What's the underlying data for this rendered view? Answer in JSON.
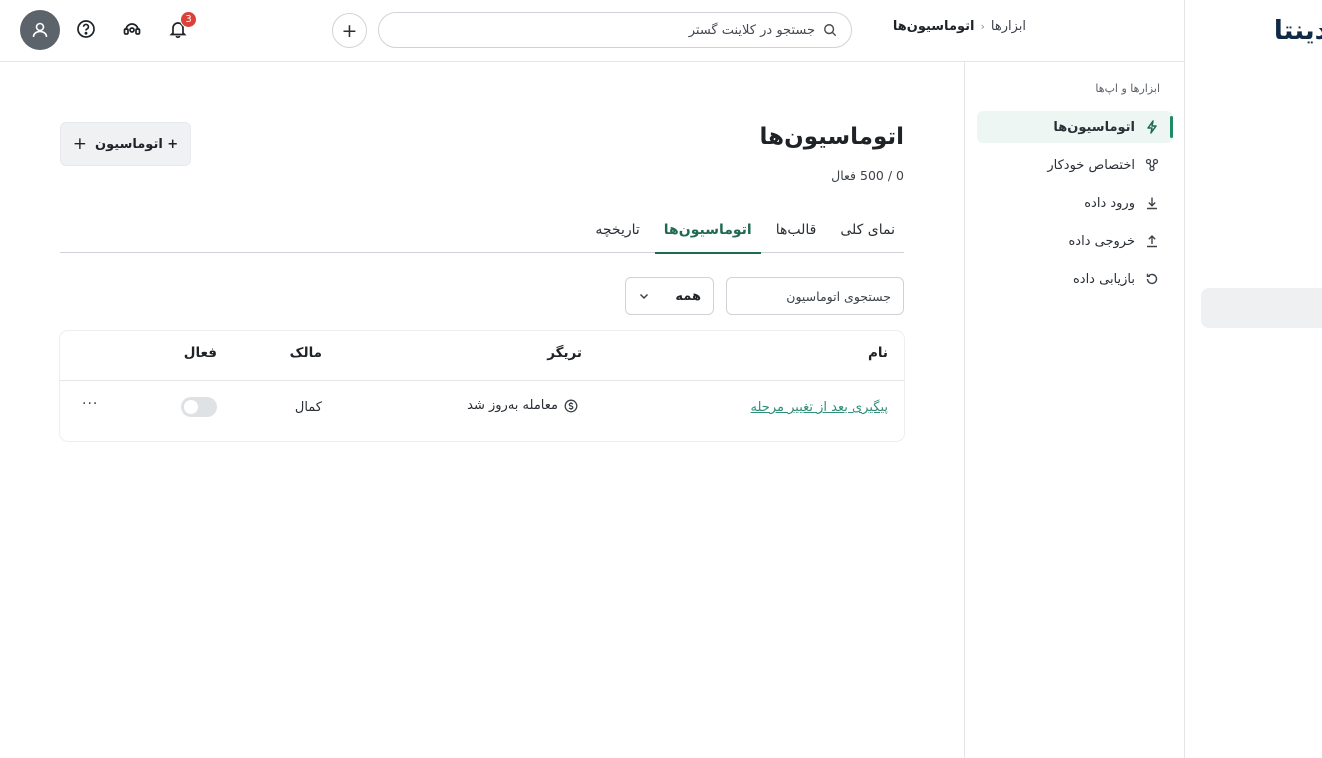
{
  "brand": {
    "logo_text": "دینتا"
  },
  "topbar": {
    "notification_count": "3",
    "search_placeholder": "جستجو در کلاینت گستر",
    "plus_label": "+",
    "breadcrumb": {
      "parent": "ابزارها",
      "separator": "‹",
      "current": "اتوماسیون‌ها"
    }
  },
  "sidebar": {
    "section_label": "ابزارها و اپ‌ها",
    "items": [
      {
        "label": "اتوماسیون‌ها",
        "icon": "bolt-icon",
        "active": true
      },
      {
        "label": "اختصاص خودکار",
        "icon": "share-icon",
        "active": false
      },
      {
        "label": "ورود داده",
        "icon": "download-icon",
        "active": false
      },
      {
        "label": "خروجی داده",
        "icon": "upload-icon",
        "active": false
      },
      {
        "label": "بازیابی داده",
        "icon": "restore-icon",
        "active": false
      }
    ]
  },
  "main": {
    "title": "اتوماسیون‌ها",
    "subtitle": "0 / 500 فعال",
    "add_button": "+ اتوماسیون",
    "tabs": [
      {
        "label": "نمای کلی",
        "active": false
      },
      {
        "label": "قالب‌ها",
        "active": false
      },
      {
        "label": "اتوماسیون‌ها",
        "active": true
      },
      {
        "label": "تاریخچه",
        "active": false
      }
    ],
    "filter_search_placeholder": "جستجوی اتوماسیون",
    "filter_select_value": "همه",
    "table": {
      "headers": {
        "name": "نام",
        "trigger": "تریگر",
        "owner": "مالک",
        "active": "فعال"
      },
      "rows": [
        {
          "name": "پیگیری بعد از تغییر مرحله",
          "trigger": "معامله به‌روز شد",
          "owner": "کمال",
          "active": false,
          "more": "···"
        }
      ]
    }
  },
  "colors": {
    "accent": "#1f6b52",
    "link": "#2f8f77",
    "badge": "#d9413a",
    "avatar": "#5d636b"
  }
}
